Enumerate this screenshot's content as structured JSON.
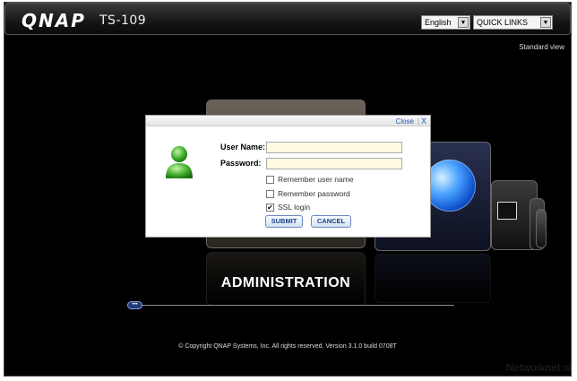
{
  "header": {
    "logo": "QNAP",
    "model": "TS-109",
    "language": "English",
    "quick_links": "QUICK LINKS",
    "dropdown_arrow": "▼"
  },
  "standard_view": "Standard view",
  "carousel": {
    "admin_title": "ADMINISTRATION",
    "scroll_handle": "•••"
  },
  "login": {
    "close_label": "Close",
    "separator": "|",
    "close_x": "X",
    "username_label": "User Name:",
    "password_label": "Password:",
    "username_value": "",
    "password_value": "",
    "remember_user": "Remember user name",
    "remember_password": "Remember password",
    "ssl_login": "SSL login",
    "ssl_checked": "✔",
    "submit": "SUBMIT",
    "cancel": "CANCEL"
  },
  "copyright": "© Copyright QNAP Systems, Inc. All rights reserved. Version 3.1.0 build 0708T",
  "watermark": "Networknet.nl",
  "colors": {
    "background": "#000000",
    "field_bg": "#fffbe0",
    "link": "#2255bb",
    "button_text": "#1a3f8a"
  }
}
